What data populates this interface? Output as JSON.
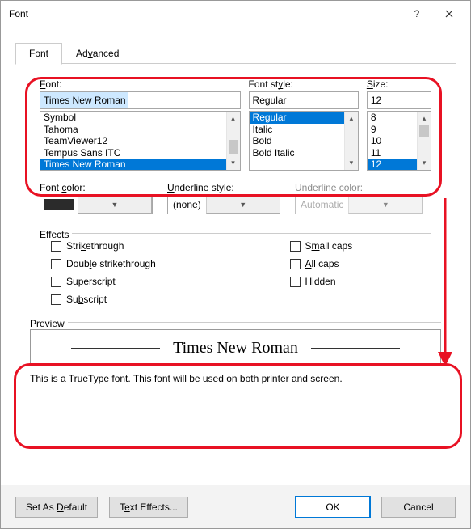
{
  "window": {
    "title": "Font"
  },
  "tabs": {
    "font": "Font",
    "advanced": "Advanced"
  },
  "font_section": {
    "label_html": "<span class='u'>F</span>ont:",
    "value": "Times New Roman",
    "items": [
      "Symbol",
      "Tahoma",
      "TeamViewer12",
      "Tempus Sans ITC",
      "Times New Roman"
    ],
    "selected": "Times New Roman"
  },
  "style_section": {
    "label_html": "Font st<span class='u'>y</span>le:",
    "value": "Regular",
    "items": [
      "Regular",
      "Italic",
      "Bold",
      "Bold Italic"
    ],
    "selected": "Regular"
  },
  "size_section": {
    "label_html": "<span class='u'>S</span>ize:",
    "value": "12",
    "items": [
      "8",
      "9",
      "10",
      "11",
      "12"
    ],
    "selected": "12"
  },
  "font_color": {
    "label_html": "Font <span class='u'>c</span>olor:",
    "swatch": "#2b2b2b"
  },
  "underline_style": {
    "label_html": "<span class='u'>U</span>nderline style:",
    "value": "(none)"
  },
  "underline_color": {
    "label": "Underline color:",
    "value": "Automatic"
  },
  "effects": {
    "heading": "Effects",
    "strikethrough": "Stri<span class='u'>k</span>ethrough",
    "double_strike": "Doub<span class='u'>l</span>e strikethrough",
    "superscript": "Su<span class='u'>p</span>erscript",
    "subscript": "Su<span class='u'>b</span>script",
    "smallcaps": "S<span class='u'>m</span>all caps",
    "allcaps": "<span class='u'>A</span>ll caps",
    "hidden": "<span class='u'>H</span>idden"
  },
  "preview": {
    "heading": "Preview",
    "sample": "Times New Roman",
    "note": "This is a TrueType font. This font will be used on both printer and screen."
  },
  "footer": {
    "default": "Set As <span class='u'>D</span>efault",
    "effects": "T<span class='u'>e</span>xt Effects...",
    "ok": "OK",
    "cancel": "Cancel"
  }
}
